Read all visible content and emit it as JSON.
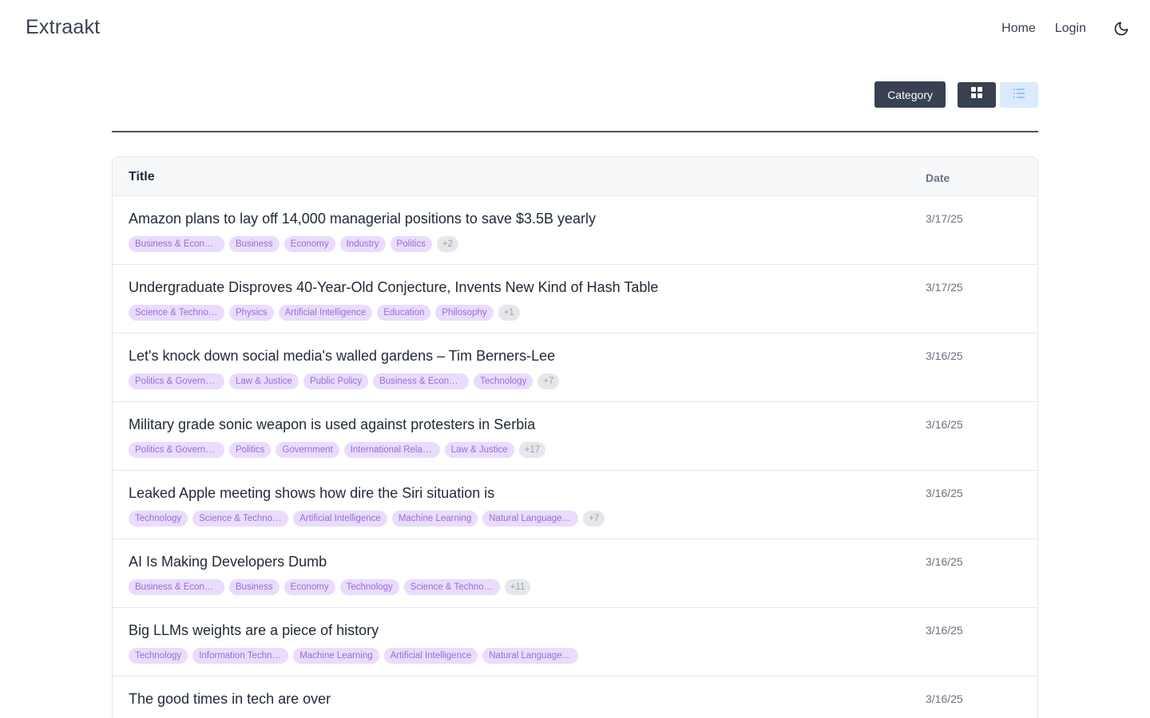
{
  "app": {
    "brand": "Extraakt"
  },
  "nav": {
    "home": "Home",
    "login": "Login",
    "theme_icon": "moon-icon"
  },
  "toolbar": {
    "category_label": "Category",
    "grid_icon": "grid-icon",
    "list_icon": "list-icon",
    "active_view": "list"
  },
  "table": {
    "headers": {
      "title": "Title",
      "date": "Date"
    },
    "rows": [
      {
        "title": "Amazon plans to lay off 14,000 managerial positions to save $3.5B yearly",
        "date": "3/17/25",
        "tags": [
          "Business & Economics",
          "Business",
          "Economy",
          "Industry",
          "Politics"
        ],
        "more": "+2"
      },
      {
        "title": "Undergraduate Disproves 40-Year-Old Conjecture, Invents New Kind of Hash Table",
        "date": "3/17/25",
        "tags": [
          "Science & Technology",
          "Physics",
          "Artificial Intelligence",
          "Education",
          "Philosophy"
        ],
        "more": "+1"
      },
      {
        "title": "Let's knock down social media's walled gardens – Tim Berners-Lee",
        "date": "3/16/25",
        "tags": [
          "Politics & Government",
          "Law & Justice",
          "Public Policy",
          "Business & Economics",
          "Technology"
        ],
        "more": "+7"
      },
      {
        "title": "Military grade sonic weapon is used against protesters in Serbia",
        "date": "3/16/25",
        "tags": [
          "Politics & Government",
          "Politics",
          "Government",
          "International Relations",
          "Law & Justice"
        ],
        "more": "+17"
      },
      {
        "title": "Leaked Apple meeting shows how dire the Siri situation is",
        "date": "3/16/25",
        "tags": [
          "Technology",
          "Science & Technology",
          "Artificial Intelligence",
          "Machine Learning",
          "Natural Language Processing"
        ],
        "more": "+7"
      },
      {
        "title": "AI Is Making Developers Dumb",
        "date": "3/16/25",
        "tags": [
          "Business & Economics",
          "Business",
          "Economy",
          "Technology",
          "Science & Technology"
        ],
        "more": "+11"
      },
      {
        "title": "Big LLMs weights are a piece of history",
        "date": "3/16/25",
        "tags": [
          "Technology",
          "Information Technology",
          "Machine Learning",
          "Artificial Intelligence",
          "Natural Language Processing"
        ],
        "more": ""
      },
      {
        "title": "The good times in tech are over",
        "date": "3/16/25",
        "tags": [],
        "more": ""
      }
    ]
  },
  "colors": {
    "accent_dark": "#374151",
    "tag_bg": "#e9dcfc",
    "tag_text": "#9a6cd6",
    "list_btn_bg": "#dbeafe"
  }
}
